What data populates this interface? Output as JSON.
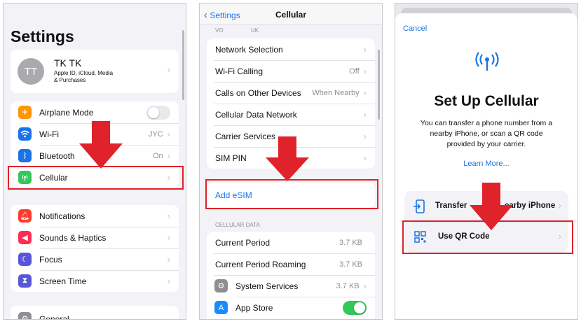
{
  "colors": {
    "blue": "#1a73e8",
    "red": "#e0222a",
    "orange": "#ff9500",
    "green": "#34c759"
  },
  "panel1": {
    "title": "Settings",
    "profile": {
      "initials": "TT",
      "name": "TK TK",
      "subtitle_line1": "Apple ID, iCloud, Media",
      "subtitle_line2": "& Purchases"
    },
    "group1": [
      {
        "label": "Airplane Mode",
        "value": "",
        "icon": "airplane-icon"
      },
      {
        "label": "Wi-Fi",
        "value": "JYC",
        "icon": "wifi-icon"
      },
      {
        "label": "Bluetooth",
        "value": "On",
        "icon": "bluetooth-icon"
      },
      {
        "label": "Cellular",
        "value": "",
        "icon": "cellular-icon"
      }
    ],
    "group2": [
      {
        "label": "Notifications",
        "icon": "notifications-icon"
      },
      {
        "label": "Sounds & Haptics",
        "icon": "sounds-icon"
      },
      {
        "label": "Focus",
        "icon": "focus-icon"
      },
      {
        "label": "Screen Time",
        "icon": "screen-time-icon"
      }
    ],
    "group3": [
      {
        "label": "General",
        "icon": "gear-icon"
      }
    ]
  },
  "panel2": {
    "back": "Settings",
    "nav_title": "Cellular",
    "carrier_header_left": "VO",
    "carrier_header_right": "UK",
    "rows": [
      {
        "label": "Network Selection",
        "value": ""
      },
      {
        "label": "Wi-Fi Calling",
        "value": "Off"
      },
      {
        "label": "Calls on Other Devices",
        "value": "When Nearby"
      },
      {
        "label": "Cellular Data Network",
        "value": ""
      },
      {
        "label": "Carrier Services",
        "value": ""
      },
      {
        "label": "SIM PIN",
        "value": ""
      }
    ],
    "add_esim": "Add eSIM",
    "cellular_data_header": "CELLULAR DATA",
    "data_rows": [
      {
        "label": "Current Period",
        "value": "3.7 KB"
      },
      {
        "label": "Current Period Roaming",
        "value": "3.7 KB"
      },
      {
        "label": "System Services",
        "value": "3.7 KB",
        "icon": "gear-icon"
      },
      {
        "label": "App Store",
        "value": "",
        "icon": "app-store-icon"
      }
    ]
  },
  "panel3": {
    "cancel": "Cancel",
    "title": "Set Up Cellular",
    "description_line1": "You can transfer a phone number from a",
    "description_line2": "nearby iPhone, or scan a QR code",
    "description_line3": "provided by your carrier.",
    "learn_more": "Learn More...",
    "option_transfer_left": "Transfer",
    "option_transfer_right": "earby iPhone",
    "option_qr": "Use QR Code"
  }
}
